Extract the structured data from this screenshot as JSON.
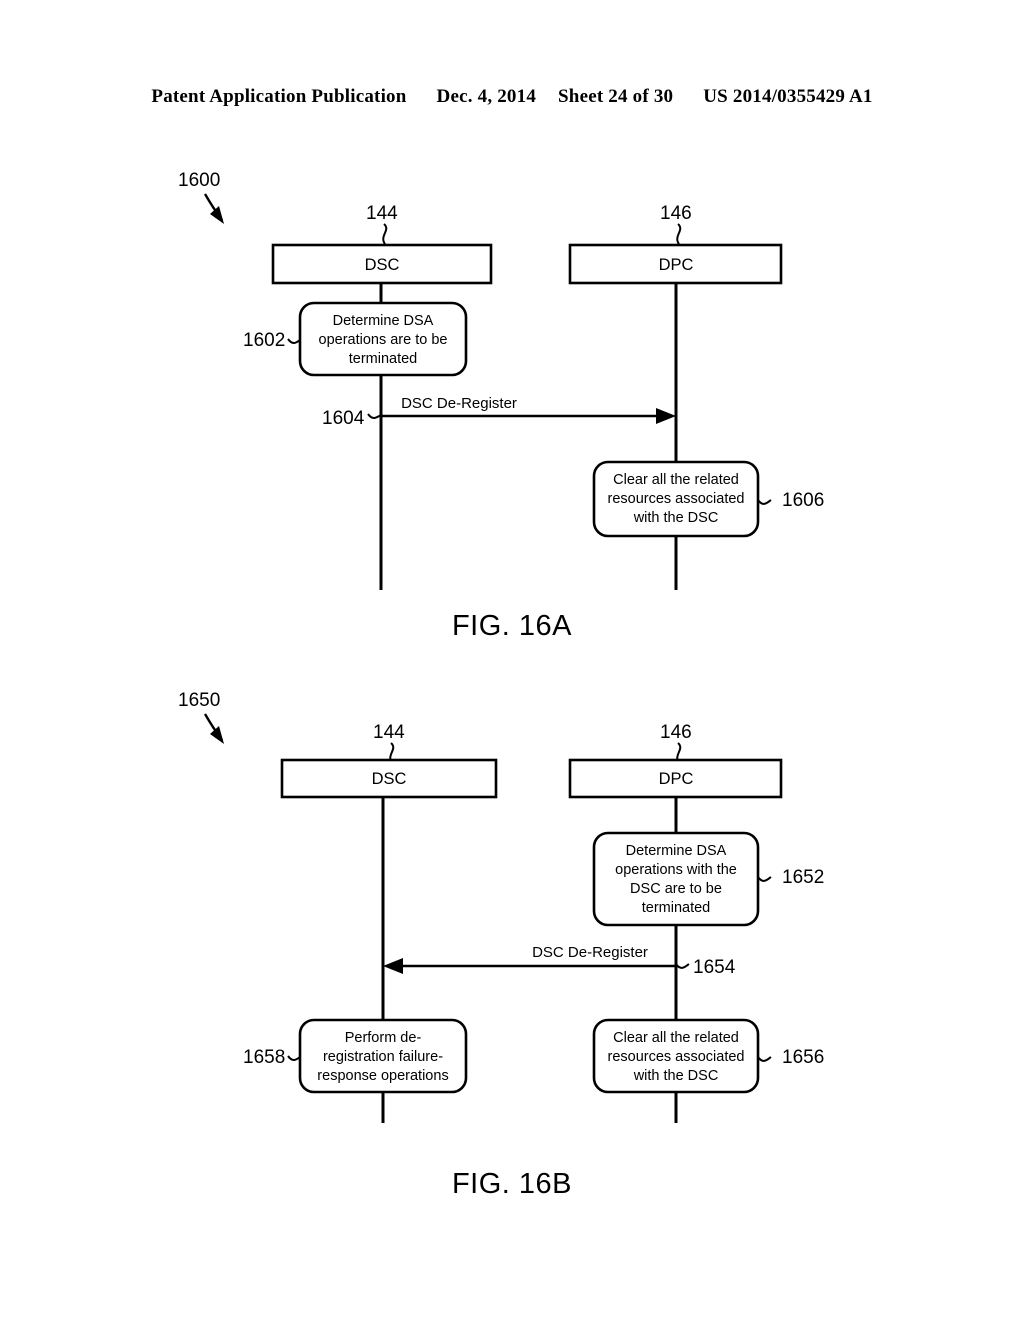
{
  "header": {
    "publication": "Patent Application Publication",
    "date": "Dec. 4, 2014",
    "sheet": "Sheet 24 of 30",
    "pub_number": "US 2014/0355429 A1"
  },
  "figures": [
    {
      "id": "fig-16a",
      "caption": "FIG. 16A",
      "diagram_ref": "1600",
      "lifelines": [
        {
          "name": "dsc",
          "label": "DSC",
          "ref": "144"
        },
        {
          "name": "dpc",
          "label": "DPC",
          "ref": "146"
        }
      ],
      "steps": [
        {
          "name": "determine-dsa-terminated",
          "ref": "1602",
          "ref_side": "left",
          "lifeline": "dsc",
          "lines": [
            "Determine DSA",
            "operations are to be",
            "terminated"
          ]
        },
        {
          "name": "clear-related-resources",
          "ref": "1606",
          "ref_side": "right",
          "lifeline": "dpc",
          "lines": [
            "Clear all the related",
            "resources associated",
            "with the DSC"
          ]
        }
      ],
      "messages": [
        {
          "name": "dsc-de-register",
          "label": "DSC De-Register",
          "ref": "1604",
          "ref_side": "left",
          "direction": "right",
          "from": "dsc",
          "to": "dpc"
        }
      ]
    },
    {
      "id": "fig-16b",
      "caption": "FIG. 16B",
      "diagram_ref": "1650",
      "lifelines": [
        {
          "name": "dsc",
          "label": "DSC",
          "ref": "144"
        },
        {
          "name": "dpc",
          "label": "DPC",
          "ref": "146"
        }
      ],
      "steps": [
        {
          "name": "determine-dsa-with-dsc-terminated",
          "ref": "1652",
          "ref_side": "right",
          "lifeline": "dpc",
          "lines": [
            "Determine DSA",
            "operations with the",
            "DSC are to be",
            "terminated"
          ]
        },
        {
          "name": "perform-deregistration-failure-response",
          "ref": "1658",
          "ref_side": "left",
          "lifeline": "dsc",
          "lines": [
            "Perform de-",
            "registration failure-",
            "response operations"
          ]
        },
        {
          "name": "clear-related-resources",
          "ref": "1656",
          "ref_side": "right",
          "lifeline": "dpc",
          "lines": [
            "Clear all the related",
            "resources associated",
            "with the DSC"
          ]
        }
      ],
      "messages": [
        {
          "name": "dsc-de-register",
          "label": "DSC De-Register",
          "ref": "1654",
          "ref_side": "right",
          "direction": "left",
          "from": "dpc",
          "to": "dsc"
        }
      ]
    }
  ]
}
